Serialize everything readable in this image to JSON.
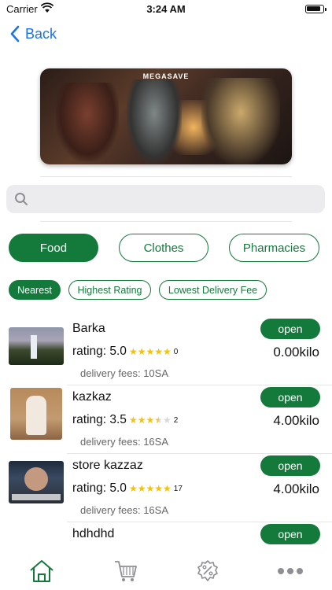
{
  "status_bar": {
    "carrier": "Carrier",
    "time": "3:24 AM"
  },
  "nav": {
    "back_label": "Back"
  },
  "banner": {
    "logo_text": "MEGASAVE"
  },
  "search": {
    "placeholder": "",
    "value": ""
  },
  "categories": [
    {
      "label": "Food",
      "active": true
    },
    {
      "label": "Clothes",
      "active": false
    },
    {
      "label": "Pharmacies",
      "active": false
    }
  ],
  "sort_options": [
    {
      "label": "Nearest",
      "active": true
    },
    {
      "label": "Highest Rating",
      "active": false
    },
    {
      "label": "Lowest Delivery Fee",
      "active": false
    }
  ],
  "stores": [
    {
      "name": "Barka",
      "rating_text": "rating: 5.0",
      "rating_value": 5.0,
      "review_count": "0",
      "distance": "0.00kilo",
      "fees": "delivery fees: 10SA",
      "status": "open"
    },
    {
      "name": "kazkaz",
      "rating_text": "rating: 3.5",
      "rating_value": 3.5,
      "review_count": "2",
      "distance": "4.00kilo",
      "fees": "delivery fees: 16SA",
      "status": "open"
    },
    {
      "name": "store kazzaz",
      "rating_text": "rating: 5.0",
      "rating_value": 5.0,
      "review_count": "17",
      "distance": "4.00kilo",
      "fees": "delivery fees: 16SA",
      "status": "open"
    },
    {
      "name": "hdhdhd",
      "rating_text": "",
      "rating_value": null,
      "review_count": "",
      "distance": "",
      "fees": "",
      "status": "open"
    }
  ],
  "tab_bar": {
    "items": [
      {
        "icon": "home-icon",
        "active": true
      },
      {
        "icon": "cart-icon",
        "active": false
      },
      {
        "icon": "discount-icon",
        "active": false
      },
      {
        "icon": "more-icon",
        "active": false
      }
    ]
  },
  "colors": {
    "accent": "#137a3c",
    "link": "#1a73e8",
    "star": "#f4c20d",
    "inactive_icon": "#8e8e93"
  }
}
